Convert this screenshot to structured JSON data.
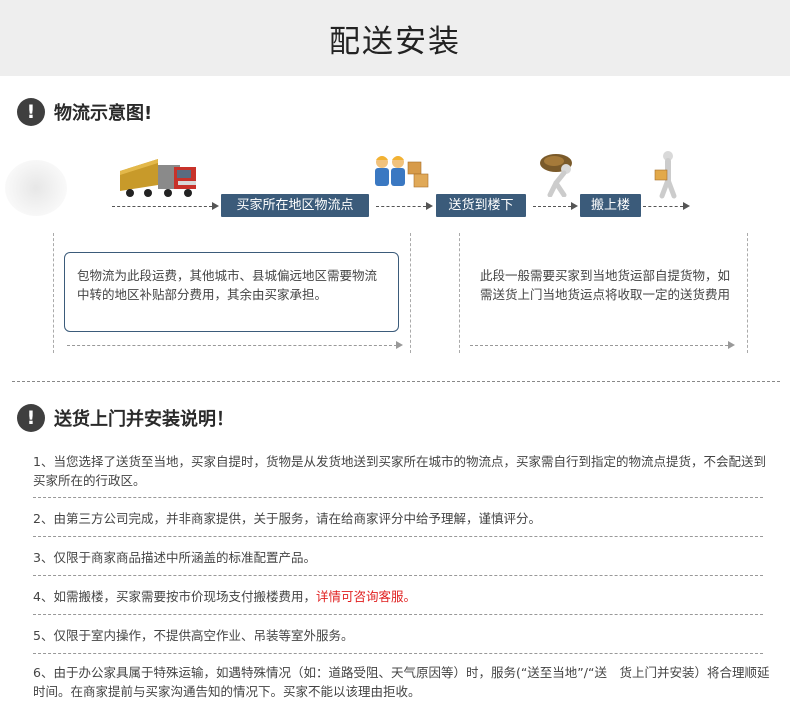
{
  "header": {
    "title": "配送安装"
  },
  "section1": {
    "title": "物流示意图!",
    "warn_symbol": "!"
  },
  "flow": {
    "steps": [
      "买家所在地区物流点",
      "送货到楼下",
      "搬上楼"
    ],
    "icons": [
      "truck-icon",
      "workers-boxes-icon",
      "porter-carrying-icon",
      "delivery-person-icon"
    ],
    "accent": "#3b5b7a"
  },
  "notes": {
    "left": "包物流为此段运费，其他城市、县城偏远地区需要物流中转的地区补贴部分费用，其余由买家承担。",
    "right": "此段一般需要买家到当地货运部自提货物，如需送货上门当地货运点将收取一定的送货费用"
  },
  "section2": {
    "title": "送货上门并安装说明！",
    "warn_symbol": "!"
  },
  "items": [
    {
      "text": "1、当您选择了送货至当地，买家自提时，货物是从发货地送到买家所在城市的物流点，买家需自行到指定的物流点提货，不会配送到买家所在的行政区。",
      "highlight": ""
    },
    {
      "text": "2、由第三方公司完成，并非商家提供，关于服务，请在给商家评分中给予理解，谨慎评分。",
      "highlight": ""
    },
    {
      "text": "3、仅限于商家商品描述中所涵盖的标准配置产品。",
      "highlight": ""
    },
    {
      "text": "4、如需搬楼，买家需要按市价现场支付搬楼费用，",
      "highlight": "详情可咨询客服。"
    },
    {
      "text": "5、仅限于室内操作，不提供高空作业、吊装等室外服务。",
      "highlight": ""
    },
    {
      "text": "6、由于办公家具属于特殊运输，如遇特殊情况（如：道路受阻、天气原因等）时，服务(“送至当地”/“送　货上门并安装）将合理顺延时间。在商家提前与买家沟通告知的情况下。买家不能以该理由拒收。",
      "highlight": ""
    }
  ],
  "colors": {
    "highlight": "#e02020",
    "header_bg": "#eeeeee"
  }
}
